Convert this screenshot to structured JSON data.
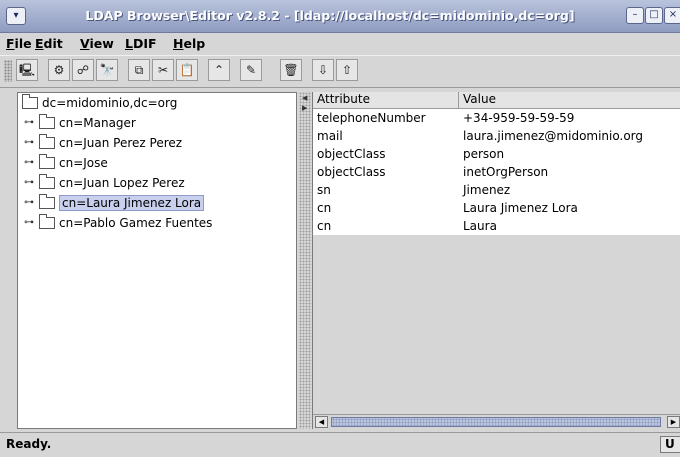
{
  "window": {
    "title": "LDAP Browser\\Editor v2.8.2 - [ldap://localhost/dc=midominio,dc=org]",
    "sys_menu_icon": "chevron-down-icon",
    "minimize_icon": "minimize-icon",
    "maximize_icon": "maximize-icon",
    "close_icon": "close-icon"
  },
  "menubar": {
    "items": [
      {
        "label_rest": "ile",
        "mnemonic": "F"
      },
      {
        "label_rest": "dit",
        "mnemonic": "E"
      },
      {
        "label_rest": "iew",
        "mnemonic": "V"
      },
      {
        "label_rest": "DIF",
        "mnemonic": "L"
      },
      {
        "label_rest": "elp",
        "mnemonic": "H"
      }
    ]
  },
  "toolbar": {
    "buttons": [
      {
        "icon": "connect-icon",
        "glyph": "🖳"
      },
      {
        "icon": "search-icon",
        "glyph": "⚙"
      },
      {
        "icon": "binoculars-icon",
        "glyph": "☍"
      },
      {
        "icon": "find-icon",
        "glyph": "🔭"
      },
      {
        "icon": "copy-icon",
        "glyph": "⧉"
      },
      {
        "icon": "cut-icon",
        "glyph": "✂"
      },
      {
        "icon": "paste-icon",
        "glyph": "📋"
      },
      {
        "icon": "move-up-icon",
        "glyph": "⌃"
      },
      {
        "icon": "edit-icon",
        "glyph": "✎"
      },
      {
        "icon": "delete-icon",
        "glyph": "🗑"
      },
      {
        "icon": "export-icon",
        "glyph": "⇩"
      },
      {
        "icon": "import-icon",
        "glyph": "⇧"
      }
    ]
  },
  "tree": {
    "root": "dc=midominio,dc=org",
    "children": [
      "cn=Manager",
      "cn=Juan Perez Perez",
      "cn=Jose",
      "cn=Juan Lopez Perez",
      "cn=Laura Jimenez Lora",
      "cn=Pablo Gamez Fuentes"
    ],
    "selected_index": 4,
    "handle_glyph": "⊶"
  },
  "table": {
    "columns": [
      "Attribute",
      "Value"
    ],
    "rows": [
      [
        "telephoneNumber",
        "+34-959-59-59-59"
      ],
      [
        "mail",
        "laura.jimenez@midominio.org"
      ],
      [
        "objectClass",
        "person"
      ],
      [
        "objectClass",
        "inetOrgPerson"
      ],
      [
        "sn",
        "Jimenez"
      ],
      [
        "cn",
        "Laura Jimenez Lora"
      ],
      [
        "cn",
        "Laura"
      ]
    ]
  },
  "status": {
    "text": "Ready.",
    "right": "U"
  }
}
